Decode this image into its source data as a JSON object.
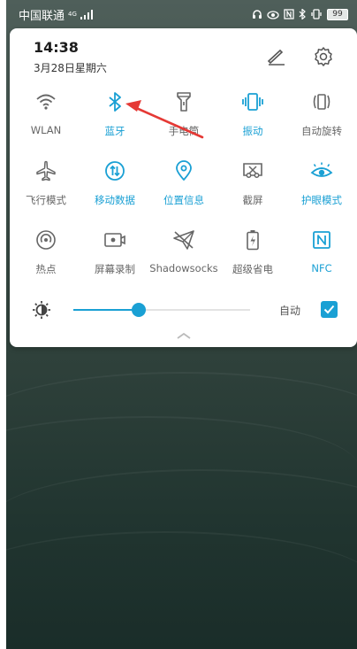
{
  "status_bar": {
    "carrier": "中国联通",
    "network": "4G",
    "battery": "99"
  },
  "header": {
    "time": "14:38",
    "date": "3月28日星期六",
    "edit_icon": "pencil-icon",
    "settings_icon": "gear-icon"
  },
  "tiles": [
    {
      "label": "WLAN",
      "icon": "wifi-icon",
      "active": false
    },
    {
      "label": "蓝牙",
      "icon": "bluetooth-icon",
      "active": true
    },
    {
      "label": "手电筒",
      "icon": "flashlight-icon",
      "active": false
    },
    {
      "label": "振动",
      "icon": "vibrate-icon",
      "active": true
    },
    {
      "label": "自动旋转",
      "icon": "rotate-icon",
      "active": false
    },
    {
      "label": "飞行模式",
      "icon": "airplane-icon",
      "active": false
    },
    {
      "label": "移动数据",
      "icon": "mobile-data-icon",
      "active": true
    },
    {
      "label": "位置信息",
      "icon": "location-icon",
      "active": true
    },
    {
      "label": "截屏",
      "icon": "screenshot-icon",
      "active": false
    },
    {
      "label": "护眼模式",
      "icon": "eye-icon",
      "active": true
    },
    {
      "label": "热点",
      "icon": "hotspot-icon",
      "active": false
    },
    {
      "label": "屏幕录制",
      "icon": "screen-record-icon",
      "active": false
    },
    {
      "label": "Shadowsocks",
      "icon": "paper-plane-icon",
      "active": false
    },
    {
      "label": "超级省电",
      "icon": "battery-saver-icon",
      "active": false
    },
    {
      "label": "NFC",
      "icon": "nfc-icon",
      "active": true
    }
  ],
  "brightness": {
    "level": 0.37,
    "auto_label": "自动",
    "auto_checked": true
  },
  "colors": {
    "accent": "#1aa0d4",
    "inactive": "#666666",
    "annotation": "#e53935"
  }
}
